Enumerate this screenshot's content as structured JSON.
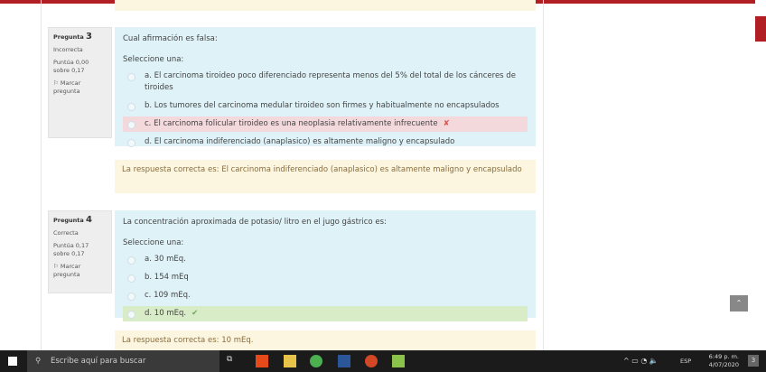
{
  "q3": {
    "label": "Pregunta",
    "num": "3",
    "state": "Incorrecta",
    "score": "Puntúa 0,00 sobre 0,17",
    "flag": "Marcar pregunta",
    "text": "Cual afirmación es falsa:",
    "select": "Seleccione una:",
    "options": [
      "a. El carcinoma tiroideo poco diferenciado representa menos del 5% del total de los cánceres de tiroides",
      "b. Los tumores del carcinoma medular tiroideo son firmes y habitualmente no encapsulados",
      "c. El carcinoma folicular tiroideo es una neoplasia relativamente infrecuente",
      "d. El carcinoma indiferenciado (anaplasico) es altamente maligno y encapsulado"
    ],
    "feedback": "La respuesta correcta es: El carcinoma indiferenciado (anaplasico) es altamente maligno y encapsulado"
  },
  "q4": {
    "label": "Pregunta",
    "num": "4",
    "state": "Correcta",
    "score": "Puntúa 0,17 sobre 0,17",
    "flag": "Marcar pregunta",
    "text": "La concentración aproximada de potasio/ litro en el jugo gástrico es:",
    "select": "Seleccione una:",
    "options": [
      "a. 30 mEq.",
      "b. 154 mEq",
      "c. 109 mEq.",
      "d. 10 mEq."
    ],
    "feedback": "La respuesta correcta es: 10 mEq."
  },
  "taskbar": {
    "search": "Escribe aquí para buscar",
    "lang": "ESP",
    "time": "6:49 p. m.",
    "date": "4/07/2020",
    "notif": "3"
  }
}
